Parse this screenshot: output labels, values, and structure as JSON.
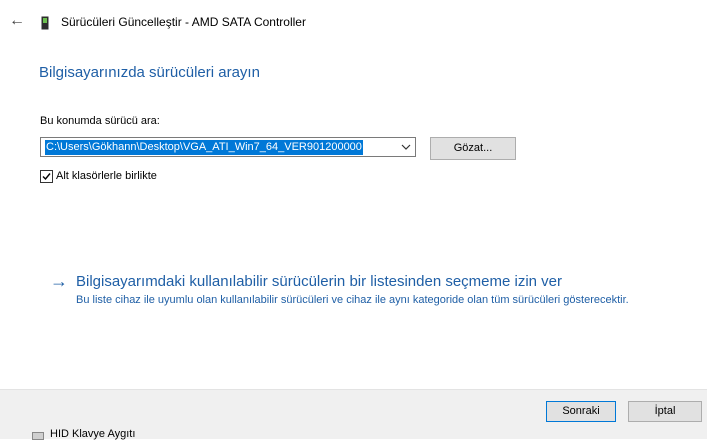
{
  "window": {
    "title": "Sürücüleri Güncelleştir - AMD SATA Controller",
    "back_icon": "back-arrow-icon",
    "device_icon": "device-icon"
  },
  "main": {
    "heading": "Bilgisayarınızda sürücüleri arayın",
    "search_label": "Bu konumda sürücü ara:",
    "path_value": "C:\\Users\\Gökhann\\Desktop\\VGA_ATI_Win7_64_VER901200000",
    "browse_label": "Gözat...",
    "include_subfolders_label": "Alt klasörlerle birlikte",
    "include_subfolders_checked": true,
    "pick_link_title": "Bilgisayarımdaki kullanılabilir sürücülerin bir listesinden seçmeme izin ver",
    "pick_link_description": "Bu liste cihaz ile uyumlu olan kullanılabilir sürücüleri ve cihaz ile aynı kategoride olan tüm sürücüleri gösterecektir."
  },
  "footer": {
    "next_label": "Sonraki",
    "cancel_label": "İptal"
  },
  "background": {
    "partial_item": "HID Klavye Aygıtı"
  },
  "colors": {
    "accent": "#0078d7",
    "link": "#1f5fa6",
    "footer_bg": "#f0f0f0"
  }
}
